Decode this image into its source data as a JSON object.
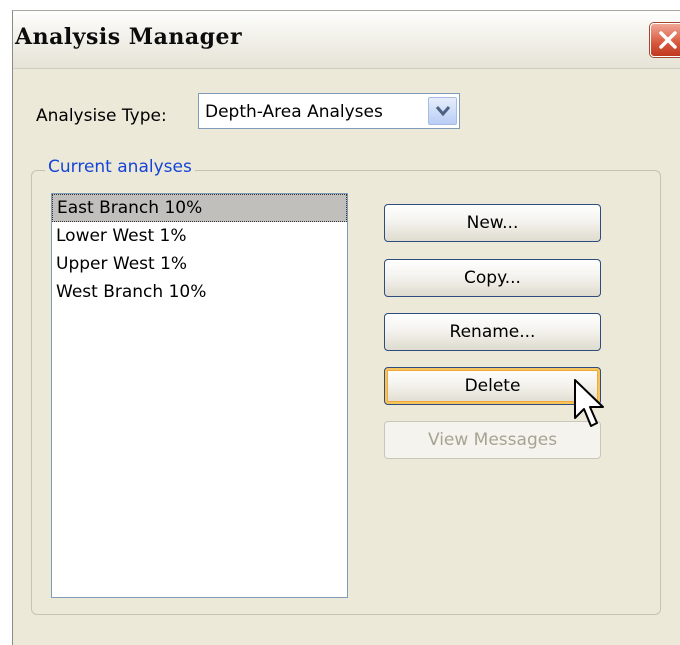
{
  "window": {
    "title": "Analysis Manager"
  },
  "analysis_type": {
    "label": "Analysise Type:",
    "selected": "Depth-Area Analyses"
  },
  "current_analyses": {
    "label": "Current analyses",
    "items": [
      {
        "label": "East Branch 10%",
        "selected": true
      },
      {
        "label": "Lower West 1%",
        "selected": false
      },
      {
        "label": "Upper West 1%",
        "selected": false
      },
      {
        "label": "West Branch 10%",
        "selected": false
      }
    ]
  },
  "buttons": {
    "new": "New...",
    "copy": "Copy...",
    "rename": "Rename...",
    "delete": "Delete",
    "view_messages": "View Messages"
  },
  "colors": {
    "group_label": "#1545d6",
    "window_bg": "#ece9d8",
    "selection": "#c0bfbb"
  }
}
